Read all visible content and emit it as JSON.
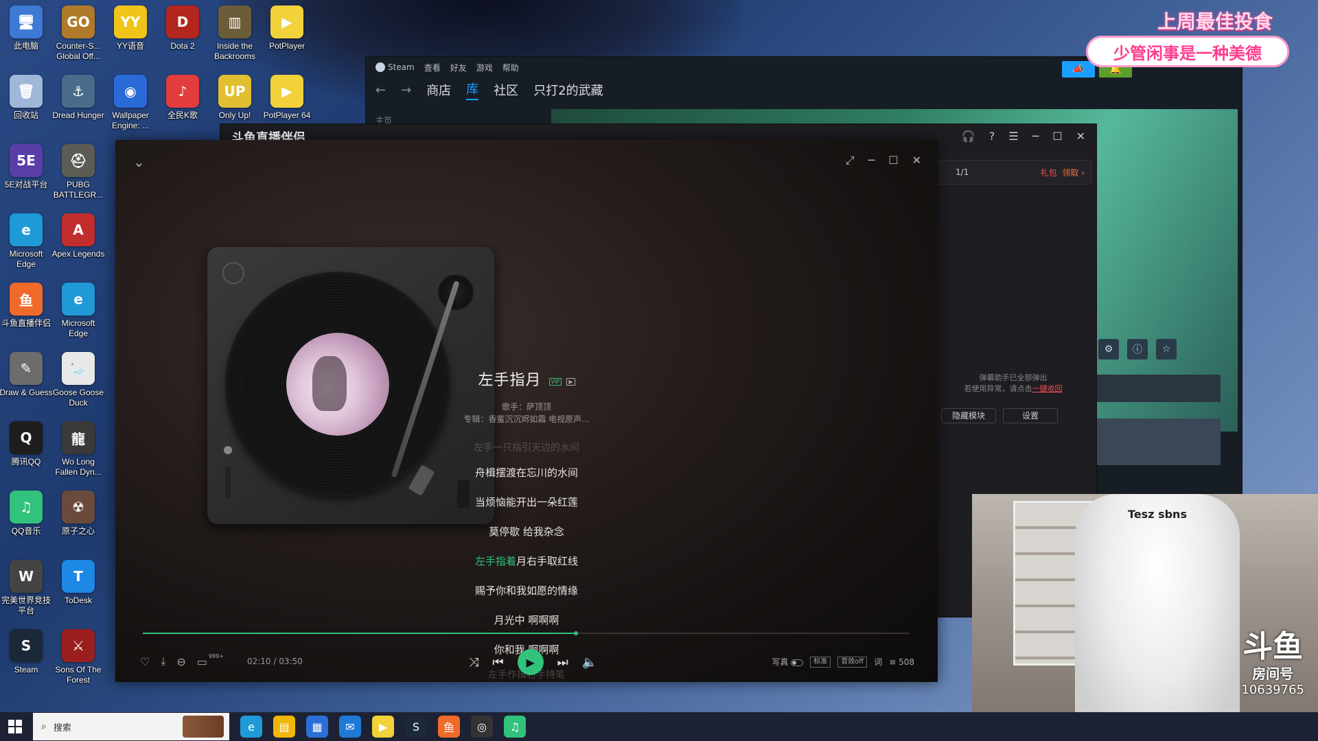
{
  "desktop": {
    "icons": [
      {
        "label": "此电脑",
        "icon": "computer-icon",
        "color": "#3d7ad6",
        "glyph": "🖥"
      },
      {
        "label": "Counter-S... Global Off...",
        "icon": "csgo-icon",
        "color": "#b07a2a",
        "glyph": "GO"
      },
      {
        "label": "YY语音",
        "icon": "yy-icon",
        "color": "#f0c419",
        "glyph": "YY"
      },
      {
        "label": "Dota 2",
        "icon": "dota2-icon",
        "color": "#b3261e",
        "glyph": "D"
      },
      {
        "label": "Inside the Backrooms",
        "icon": "backrooms-icon",
        "color": "#6b5d3a",
        "glyph": "▥"
      },
      {
        "label": "PotPlayer",
        "icon": "potplayer-icon",
        "color": "#f1d23a",
        "glyph": "▶"
      },
      {
        "label": "回收站",
        "icon": "recycle-bin-icon",
        "color": "#9fb7d9",
        "glyph": "🗑"
      },
      {
        "label": "Dread Hunger",
        "icon": "dread-hunger-icon",
        "color": "#4a6b8a",
        "glyph": "⚓"
      },
      {
        "label": "Wallpaper Engine: ...",
        "icon": "wallpaper-engine-icon",
        "color": "#2a6ad6",
        "glyph": "◉"
      },
      {
        "label": "全民K歌",
        "icon": "kge-icon",
        "color": "#e23c3c",
        "glyph": "♪"
      },
      {
        "label": "Only Up!",
        "icon": "only-up-icon",
        "color": "#e0c030",
        "glyph": "UP"
      },
      {
        "label": "PotPlayer 64",
        "icon": "potplayer64-icon",
        "color": "#f1d23a",
        "glyph": "▶"
      },
      {
        "label": "5E对战平台",
        "icon": "5e-icon",
        "color": "#5a3ea8",
        "glyph": "5E"
      },
      {
        "label": "PUBG BATTLEGR...",
        "icon": "pubg-icon",
        "color": "#5c5c54",
        "glyph": "⛑"
      },
      {
        "label": "Microsoft Edge",
        "icon": "edge-icon",
        "color": "#1f9ad6",
        "glyph": "e"
      },
      {
        "label": "Apex Legends",
        "icon": "apex-icon",
        "color": "#c22d2d",
        "glyph": "A"
      },
      {
        "label": "斗鱼直播伴侣",
        "icon": "douyu-assistant-icon",
        "color": "#f06a2a",
        "glyph": "鱼"
      },
      {
        "label": "Microsoft Edge",
        "icon": "edge-icon",
        "color": "#1f9ad6",
        "glyph": "e"
      },
      {
        "label": "Draw & Guess",
        "icon": "draw-guess-icon",
        "color": "#6c6c6c",
        "glyph": "✎"
      },
      {
        "label": "Goose Goose Duck",
        "icon": "goose-icon",
        "color": "#e8e8e8",
        "glyph": "🦢"
      },
      {
        "label": "腾讯QQ",
        "icon": "qq-icon",
        "color": "#1d1d1d",
        "glyph": "Q"
      },
      {
        "label": "Wo Long Fallen Dyn...",
        "icon": "wolong-icon",
        "color": "#3a3a3a",
        "glyph": "龍"
      },
      {
        "label": "QQ音乐",
        "icon": "qq-music-icon",
        "color": "#31c27c",
        "glyph": "♫"
      },
      {
        "label": "原子之心",
        "icon": "atomic-heart-icon",
        "color": "#6a4a3a",
        "glyph": "☢"
      },
      {
        "label": "完美世界竞技平台",
        "icon": "perfect-world-icon",
        "color": "#444444",
        "glyph": "W"
      },
      {
        "label": "ToDesk",
        "icon": "todesk-icon",
        "color": "#1e88e5",
        "glyph": "T"
      },
      {
        "label": "Steam",
        "icon": "steam-icon",
        "color": "#1b2838",
        "glyph": "S"
      },
      {
        "label": "Sons Of The Forest",
        "icon": "sons-forest-icon",
        "color": "#9a1e1e",
        "glyph": "⚔"
      }
    ]
  },
  "steam": {
    "menu": [
      "Steam",
      "查看",
      "好友",
      "游戏",
      "帮助"
    ],
    "nav": {
      "back": "←",
      "forward": "→",
      "store": "商店",
      "library": "库",
      "community": "社区",
      "profile": "只打2的武藏"
    },
    "sidebar_home": "主页",
    "nav_colors": {
      "accent": "#1a9fff"
    }
  },
  "assistant": {
    "title": "斗鱼直播伴侣",
    "page": "1/1",
    "gift": "礼包",
    "claim": "领取",
    "note_line1": "弹幕助手已全部弹出",
    "note_line2": "若使用异常，请点击",
    "note_link": "一键收回",
    "btn_hide": "隐藏模块",
    "btn_settings": "设置"
  },
  "player": {
    "song": "左手指月",
    "vip": "VIP",
    "mv": "▶",
    "singer": "歌手：萨顶顶",
    "album": "专辑：香蜜沉沉烬如霜 电视原声...",
    "lyrics": [
      {
        "text": "左手一只指引天边的水间",
        "state": "faded"
      },
      {
        "text": "舟楫摆渡在忘川的水间",
        "state": "normal"
      },
      {
        "text": "当烦恼能开出一朵红莲",
        "state": "normal"
      },
      {
        "text": "莫停歇 给我杂念",
        "state": "normal"
      },
      {
        "sung": "左手指着",
        "rest": "月右手取红线",
        "state": "current"
      },
      {
        "text": "赐予你和我如愿的情缘",
        "state": "normal"
      },
      {
        "text": "月光中 啊啊啊",
        "state": "normal"
      },
      {
        "text": "你和我 啊啊啊",
        "state": "normal"
      },
      {
        "text": "左手作揖右手持笔",
        "state": "faded"
      }
    ],
    "time": "02:10 / 03:50",
    "progress": 0.565,
    "comment_count": "999+",
    "right_controls": {
      "portrait": "写真",
      "quality": "标准",
      "effect": "音效off",
      "lyric": "词",
      "playlist_count": "508"
    },
    "accent": "#31c27c"
  },
  "overlay": {
    "title": "上周最佳投食",
    "name": "少管闲事是一种美德",
    "room_logo": "斗鱼",
    "room_label": "房间号",
    "room_number": "10639765",
    "chair_brand": "Tesz sbns"
  },
  "taskbar": {
    "search_placeholder": "搜索",
    "apps": [
      {
        "icon": "edge-icon",
        "color": "#1f9ad6",
        "glyph": "e"
      },
      {
        "icon": "file-explorer-icon",
        "color": "#f2b705",
        "glyph": "▤"
      },
      {
        "icon": "store-icon",
        "color": "#2b6fd6",
        "glyph": "▦"
      },
      {
        "icon": "mail-icon",
        "color": "#1f7ad6",
        "glyph": "✉"
      },
      {
        "icon": "potplayer-icon",
        "color": "#f1d23a",
        "glyph": "▶"
      },
      {
        "icon": "steam-icon",
        "color": "#1b2838",
        "glyph": "S"
      },
      {
        "icon": "douyu-assistant-icon",
        "color": "#f06a2a",
        "glyph": "鱼"
      },
      {
        "icon": "obs-icon",
        "color": "#333333",
        "glyph": "◎"
      },
      {
        "icon": "qq-music-icon",
        "color": "#31c27c",
        "glyph": "♫"
      }
    ]
  }
}
